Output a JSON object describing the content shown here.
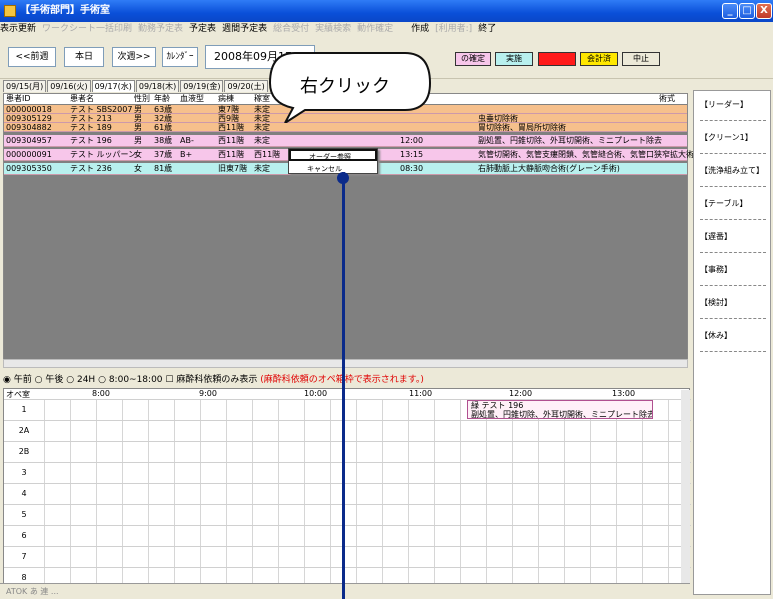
{
  "window": {
    "title": "【手術部門】手術室",
    "btn_min": "_",
    "btn_max": "□",
    "btn_close": "X"
  },
  "menu": [
    "表示更新",
    "ワークシート一括印刷",
    "勤務予定表",
    "予定表",
    "週間予定表",
    "総合受付",
    "実績検索",
    "動作確定",
    "",
    "",
    "作成",
    "[利用者:]",
    "終了"
  ],
  "menu_disabled": [
    false,
    true,
    true,
    false,
    false,
    true,
    true,
    true,
    false,
    false,
    false,
    true,
    false
  ],
  "toolbar": {
    "prev_week": "<<前週",
    "today": "本日",
    "next_week": "次週>>",
    "calendar": "ｶﾚﾝﾀﾞｰ",
    "date": "2008年09月17",
    "confirm": "の確定",
    "actual": "実施",
    "cancelled": "",
    "done": "会計済",
    "stop": "中止"
  },
  "tabs": [
    "09/15(月)",
    "09/16(火)",
    "09/17(水)",
    "09/18(木)",
    "09/19(金)",
    "09/20(土)"
  ],
  "columns": {
    "id": "患者ID",
    "name": "患者名",
    "sex": "性別",
    "age": "年齢",
    "blood": "血液型",
    "ward": "病棟",
    "status": "稼室",
    "proc": "術式"
  },
  "rows": [
    {
      "id": "000000018",
      "name": "テスト SBS2007",
      "sex": "男",
      "age": "63歳",
      "blood": "",
      "ward": "東7階",
      "status": "未定",
      "time": "",
      "proc": ""
    },
    {
      "id": "009305129",
      "name": "テスト 213",
      "sex": "男",
      "age": "32歳",
      "blood": "",
      "ward": "西9階",
      "status": "未定",
      "time": "",
      "proc": "虫垂切除術"
    },
    {
      "id": "009304882",
      "name": "テスト 189",
      "sex": "男",
      "age": "61歳",
      "blood": "",
      "ward": "西11階",
      "status": "未定",
      "time": "",
      "proc": "胃切除術、胃局所切除術"
    },
    {
      "id": "009304957",
      "name": "テスト 196",
      "sex": "男",
      "age": "38歳",
      "blood": "AB-",
      "ward": "西11階",
      "status": "未定",
      "time": "12:00",
      "proc": "副処置、円錐切除、外耳切開術、ミニプレート除去"
    },
    {
      "id": "000000091",
      "name": "テスト ルッパーン",
      "sex": "女",
      "age": "37歳",
      "blood": "B+",
      "ward": "西11階",
      "status": "西11階",
      "time": "13:15",
      "proc": "気管切開術、気管支瘻閉鎖、気管縫合術、気管口狭窄拡大術"
    },
    {
      "id": "009305350",
      "name": "テスト 236",
      "sex": "女",
      "age": "81歳",
      "blood": "",
      "ward": "旧東7階",
      "status": "未定",
      "time": "08:30",
      "proc": "右肺動脈上大静脈吻合術(グレーン手術)"
    }
  ],
  "row_colors": [
    "#f6c08c",
    "#f6c08c",
    "#f6c08c",
    "#f7c6ea",
    "#f7c6ea",
    "#b8f0ee"
  ],
  "context_menu": {
    "item1": "オーダー参照",
    "item2": "キャンセル"
  },
  "bubble": "右クリック",
  "right_panel": [
    "【リーダー】",
    "【クリーン1】",
    "【洗浄組み立て】",
    "【テーブル】",
    "【遅番】",
    "【事務】",
    "【検討】",
    "【休み】"
  ],
  "filters": {
    "am": "午前",
    "pm": "午後",
    "h24": "24H",
    "range": "8:00~18:00",
    "only_anes": "麻酔科依頼のみ表示",
    "note": "(麻酔科依頼のオペ箱枠で表示されます。)"
  },
  "schedule": {
    "header": "オペ室",
    "times": [
      "8:00",
      "9:00",
      "10:00",
      "11:00",
      "12:00",
      "13:00"
    ],
    "rooms": [
      "1",
      "2A",
      "2B",
      "3",
      "4",
      "5",
      "6",
      "7",
      "8"
    ],
    "block_line1": "緑 テスト 196",
    "block_line2": "副処置、円錐切除、外耳切開術、ミニプレート除去"
  },
  "bottom": "ATOK あ 連 ..."
}
